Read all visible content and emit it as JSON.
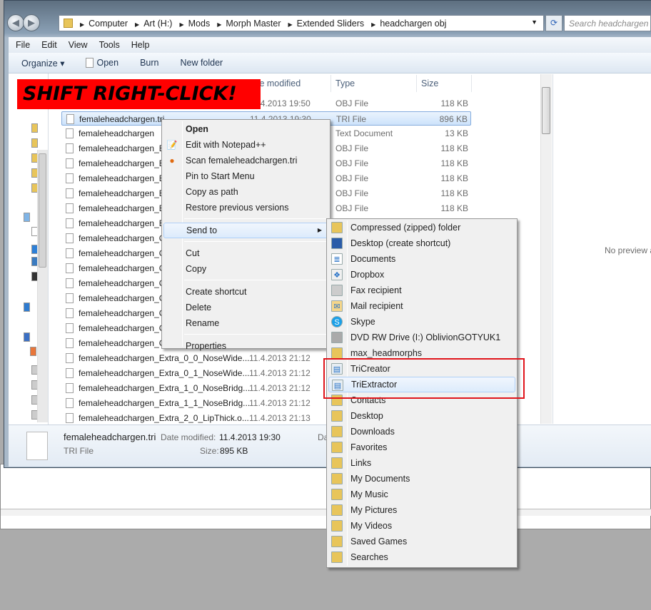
{
  "address": {
    "crumbs": [
      "Computer",
      "Art (H:)",
      "Mods",
      "Morph Master",
      "Extended Sliders",
      "headchargen obj"
    ],
    "search_placeholder": "Search headchargen obj"
  },
  "menubar": [
    "File",
    "Edit",
    "View",
    "Tools",
    "Help"
  ],
  "toolbar": {
    "organize": "Organize ▾",
    "open": "Open",
    "burn": "Burn",
    "new_folder": "New folder"
  },
  "columns": {
    "date": "te modified",
    "type": "Type",
    "size": "Size"
  },
  "banner": "SHIFT RIGHT-CLICK!",
  "files": [
    {
      "name": "",
      "date": "11.4.2013 19:50",
      "type": "OBJ File",
      "size": "118 KB"
    },
    {
      "name": "femaleheadchargen.tri",
      "date": "11.4.2013 19:30",
      "type": "TRI File",
      "size": "896 KB",
      "selected": true
    },
    {
      "name": "femaleheadchargen",
      "date": "",
      "type": "Text Document",
      "size": "13 KB"
    },
    {
      "name": "femaleheadchargen_B",
      "date": "",
      "type": "OBJ File",
      "size": "118 KB"
    },
    {
      "name": "femaleheadchargen_B",
      "date": "",
      "type": "OBJ File",
      "size": "118 KB"
    },
    {
      "name": "femaleheadchargen_B",
      "date": "",
      "type": "OBJ File",
      "size": "118 KB"
    },
    {
      "name": "femaleheadchargen_B",
      "date": "",
      "type": "OBJ File",
      "size": "118 KB"
    },
    {
      "name": "femaleheadchargen_B",
      "date": "",
      "type": "OBJ File",
      "size": "118 KB"
    },
    {
      "name": "femaleheadchargen_B",
      "date": "",
      "type": "",
      "size": ""
    },
    {
      "name": "femaleheadchargen_C",
      "date": "",
      "type": "",
      "size": ""
    },
    {
      "name": "femaleheadchargen_C",
      "date": "",
      "type": "",
      "size": ""
    },
    {
      "name": "femaleheadchargen_C",
      "date": "",
      "type": "",
      "size": ""
    },
    {
      "name": "femaleheadchargen_C",
      "date": "",
      "type": "",
      "size": ""
    },
    {
      "name": "femaleheadchargen_C",
      "date": "",
      "type": "",
      "size": ""
    },
    {
      "name": "femaleheadchargen_C",
      "date": "",
      "type": "",
      "size": ""
    },
    {
      "name": "femaleheadchargen_C",
      "date": "",
      "type": "",
      "size": ""
    },
    {
      "name": "femaleheadchargen_C",
      "date": "",
      "type": "",
      "size": ""
    },
    {
      "name": "femaleheadchargen_Extra_0_0_NoseWide...",
      "date": "11.4.2013 21:12",
      "type": "",
      "size": ""
    },
    {
      "name": "femaleheadchargen_Extra_0_1_NoseWide...",
      "date": "11.4.2013 21:12",
      "type": "",
      "size": ""
    },
    {
      "name": "femaleheadchargen_Extra_1_0_NoseBridg...",
      "date": "11.4.2013 21:12",
      "type": "",
      "size": ""
    },
    {
      "name": "femaleheadchargen_Extra_1_1_NoseBridg...",
      "date": "11.4.2013 21:12",
      "type": "",
      "size": ""
    },
    {
      "name": "femaleheadchargen_Extra_2_0_LipThick.o...",
      "date": "11.4.2013 21:13",
      "type": "",
      "size": ""
    }
  ],
  "preview_text": "No preview a",
  "details": {
    "name": "femaleheadchargen.tri",
    "type": "TRI File",
    "date_label": "Date modified:",
    "date": "11.4.2013 19:30",
    "size_label": "Size:",
    "size": "895 KB",
    "extra": "Da"
  },
  "context_menu": [
    {
      "label": "Open",
      "bold": true,
      "icon": ""
    },
    {
      "label": "Edit with Notepad++",
      "icon": "notepad-icon"
    },
    {
      "label": "Scan femaleheadchargen.tri",
      "icon": "antivirus-icon"
    },
    {
      "label": "Pin to Start Menu"
    },
    {
      "label": "Copy as path"
    },
    {
      "label": "Restore previous versions"
    },
    {
      "sep": true
    },
    {
      "label": "Send to",
      "submenu": true,
      "highlight": true
    },
    {
      "sep": true
    },
    {
      "label": "Cut"
    },
    {
      "label": "Copy"
    },
    {
      "sep": true
    },
    {
      "label": "Create shortcut"
    },
    {
      "label": "Delete"
    },
    {
      "label": "Rename"
    },
    {
      "sep": true
    },
    {
      "label": "Properties"
    }
  ],
  "send_to": [
    {
      "label": "Compressed (zipped) folder",
      "icon": "zip-folder-icon"
    },
    {
      "label": "Desktop (create shortcut)",
      "icon": "desktop-icon"
    },
    {
      "label": "Documents",
      "icon": "documents-icon"
    },
    {
      "label": "Dropbox",
      "icon": "dropbox-icon"
    },
    {
      "label": "Fax recipient",
      "icon": "fax-icon"
    },
    {
      "label": "Mail recipient",
      "icon": "mail-icon"
    },
    {
      "label": "Skype",
      "icon": "skype-icon"
    },
    {
      "label": "DVD RW Drive (I:) OblivionGOTYUK1",
      "icon": "dvd-drive-icon"
    },
    {
      "label": "max_headmorphs",
      "icon": "zip-folder-icon"
    },
    {
      "label": "TriCreator",
      "icon": "app-icon"
    },
    {
      "label": "TriExtractor",
      "icon": "app-icon",
      "highlight": true
    },
    {
      "label": "Contacts",
      "icon": "folder-icon"
    },
    {
      "label": "Desktop",
      "icon": "folder-icon"
    },
    {
      "label": "Downloads",
      "icon": "folder-icon"
    },
    {
      "label": "Favorites",
      "icon": "folder-icon"
    },
    {
      "label": "Links",
      "icon": "folder-icon"
    },
    {
      "label": "My Documents",
      "icon": "folder-icon"
    },
    {
      "label": "My Music",
      "icon": "folder-icon"
    },
    {
      "label": "My Pictures",
      "icon": "folder-icon"
    },
    {
      "label": "My Videos",
      "icon": "folder-icon"
    },
    {
      "label": "Saved Games",
      "icon": "folder-icon"
    },
    {
      "label": "Searches",
      "icon": "folder-icon"
    }
  ],
  "colors": {
    "banner": "#ff0000",
    "highlight_box": "#e0141b",
    "selection": "#cde3fb"
  }
}
